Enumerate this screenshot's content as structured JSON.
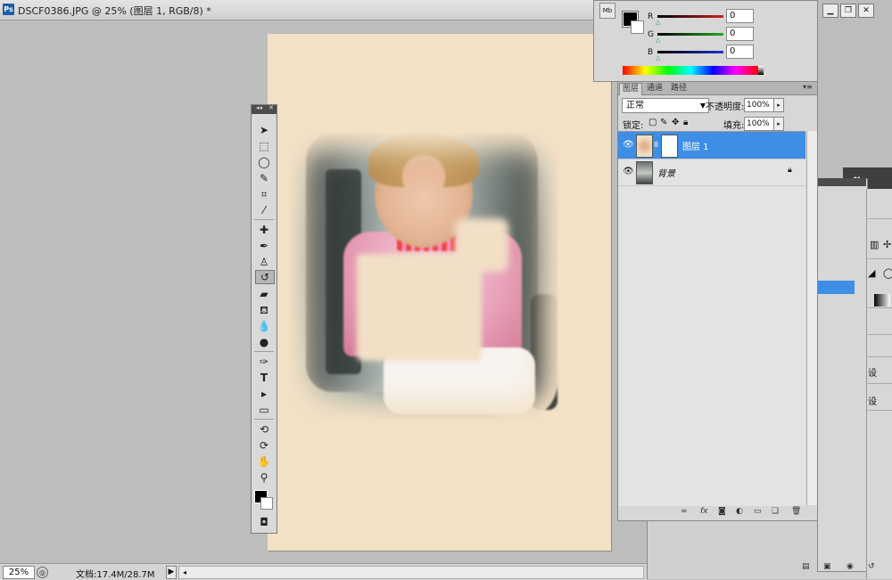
{
  "document": {
    "title": "DSCF0386.JPG @ 25% (图层 1, RGB/8) *",
    "app_icon": "Ps"
  },
  "status_bar": {
    "zoom": "25%",
    "doc_info": "文档:17.4M/28.7M",
    "arrow": "▶"
  },
  "color_panel": {
    "mini_bridge_label": "Mb",
    "channels": [
      {
        "label": "R",
        "value": "0",
        "color": "#cc2222"
      },
      {
        "label": "G",
        "value": "0",
        "color": "#22aa22"
      },
      {
        "label": "B",
        "value": "0",
        "color": "#2233cc"
      }
    ]
  },
  "layers_panel": {
    "tabs": [
      "图层",
      "通道",
      "路径"
    ],
    "blend_mode": "正常",
    "opacity_label": "不透明度:",
    "opacity_value": "100%",
    "lock_label": "锁定:",
    "fill_label": "填充:",
    "fill_value": "100%",
    "layers": [
      {
        "name": "图层 1",
        "selected": true,
        "has_mask": true
      },
      {
        "name": "背景",
        "selected": false,
        "locked": true
      }
    ],
    "footer_icons": [
      "link-layers-icon",
      "fx-icon",
      "add-mask-icon",
      "adjustment-icon",
      "group-icon",
      "new-layer-icon",
      "delete-layer-icon"
    ]
  },
  "tools": [
    "move-tool-icon",
    "marquee-tool-icon",
    "lasso-tool-icon",
    "quick-select-tool-icon",
    "crop-tool-icon",
    "eyedropper-tool-icon",
    "healing-brush-tool-icon",
    "brush-tool-icon",
    "clone-stamp-tool-icon",
    "history-brush-tool-icon",
    "eraser-tool-icon",
    "paint-bucket-tool-icon",
    "blur-tool-icon",
    "dodge-tool-icon",
    "pen-tool-icon",
    "type-tool-icon",
    "path-select-tool-icon",
    "shape-tool-icon",
    "3d-rotate-tool-icon",
    "3d-orbit-tool-icon",
    "hand-tool-icon",
    "zoom-tool-icon"
  ],
  "dock": {
    "items": [
      "设",
      "设"
    ]
  }
}
